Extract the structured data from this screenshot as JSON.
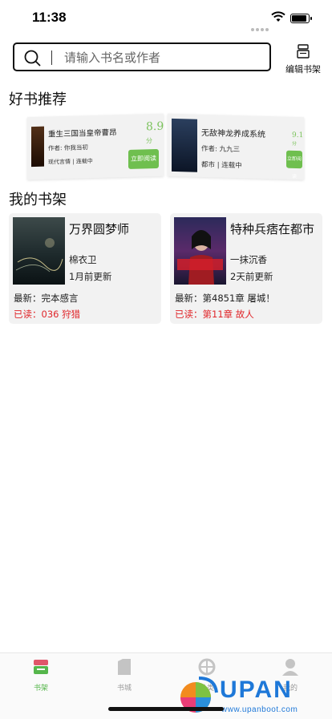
{
  "status_bar": {
    "time": "11:38"
  },
  "search": {
    "placeholder": "请输入书名或作者",
    "value": ""
  },
  "edit_shelf": {
    "label": "编辑书架",
    "icon": "edit-shelf-icon"
  },
  "recommend": {
    "title": "好书推荐",
    "cards": [
      {
        "name": "重生三国当皇帝曹昂",
        "score": "8.9",
        "score_suffix": "分",
        "author": "作者: 你我当初",
        "meta": "现代言情 | 连载中",
        "button": "立即阅读"
      },
      {
        "name": "无敌神龙养成系统",
        "score": "9.1",
        "score_suffix": "分",
        "author": "作者: 九九三",
        "meta": "都市 | 连载中",
        "button": "立即阅读"
      }
    ]
  },
  "shelf": {
    "title": "我的书架",
    "books": [
      {
        "title": "万界圆梦师",
        "author": "棉衣卫",
        "updated": "1月前更新",
        "latest": "最新：完本感言",
        "read": "已读：036 狩猎"
      },
      {
        "title": "特种兵痞在都市",
        "author": "一抹沉香",
        "updated": "2天前更新",
        "latest": "最新：第4851章 屠城！",
        "read": "已读：第11章 故人"
      }
    ]
  },
  "tabs": [
    {
      "label": "书架",
      "icon": "bookshelf-icon",
      "active": true
    },
    {
      "label": "书城",
      "icon": "bookstore-icon",
      "active": false
    },
    {
      "label": "分类",
      "icon": "category-icon",
      "active": false
    },
    {
      "label": "我的",
      "icon": "profile-icon",
      "active": false
    }
  ],
  "watermark": {
    "brand": "UPAN",
    "url": "www.upanboot.com"
  },
  "colors": {
    "accent_green": "#55b64b",
    "read_red": "#e0262a",
    "watermark_blue": "#1e78d8"
  }
}
